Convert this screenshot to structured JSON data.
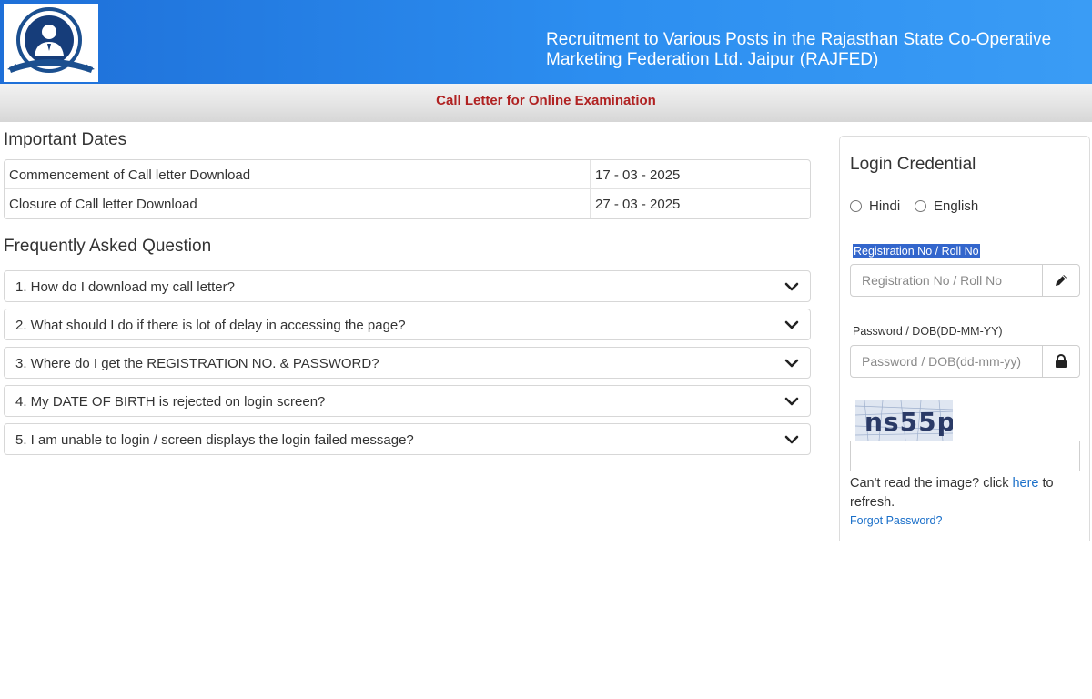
{
  "header": {
    "title_line1": "Recruitment to Various Posts in the Rajasthan State Co-Operative",
    "title_line2": "Marketing Federation Ltd. Jaipur (RAJFED)",
    "logo_icon": "person-emblem-icon"
  },
  "subheader": {
    "title": "Call Letter for Online Examination"
  },
  "important_dates": {
    "title": "Important Dates",
    "rows": [
      {
        "label": "Commencement of Call letter Download",
        "value": "17 - 03 - 2025"
      },
      {
        "label": "Closure of Call letter Download",
        "value": "27 - 03 - 2025"
      }
    ]
  },
  "faq": {
    "title": "Frequently Asked Question",
    "items": [
      {
        "question": "1. How do I download my call letter?"
      },
      {
        "question": "2. What should I do if there is lot of delay in accessing the page?"
      },
      {
        "question": "3. Where do I get the REGISTRATION NO. & PASSWORD?"
      },
      {
        "question": "4. My DATE OF BIRTH is rejected on login screen?"
      },
      {
        "question": "5. I am unable to login / screen displays the login failed message?"
      }
    ]
  },
  "login": {
    "title": "Login Credential",
    "languages": [
      "Hindi",
      "English"
    ],
    "registration_label": "Registration No / Roll No",
    "registration_placeholder": "Registration No / Roll No",
    "password_label": "Password / DOB(DD-MM-YY)",
    "password_placeholder": "Password / DOB(dd-mm-yy)",
    "captcha_text": "ns55p",
    "refresh_prefix": "Can't read the image? click ",
    "refresh_link": "here",
    "refresh_suffix": " to refresh.",
    "forgot_password": "Forgot Password?"
  },
  "colors": {
    "header_blue": "#2c8ef0",
    "subtitle_red": "#b02222",
    "link_blue": "#1a6fc9",
    "highlight_blue": "#3366cc"
  }
}
